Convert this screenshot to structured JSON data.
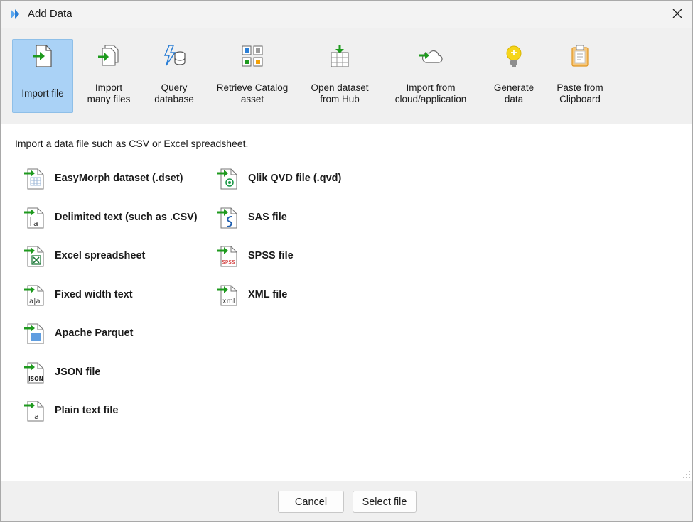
{
  "window": {
    "title": "Add Data"
  },
  "ribbon": {
    "buttons": [
      {
        "label": "Import file",
        "icon": "import-file-icon",
        "active": true
      },
      {
        "label": "Import\nmany files",
        "icon": "import-many-files-icon",
        "active": false
      },
      {
        "label": "Query\ndatabase",
        "icon": "query-database-icon",
        "active": false
      },
      {
        "label": "Retrieve Catalog\nasset",
        "icon": "catalog-asset-icon",
        "active": false
      },
      {
        "label": "Open dataset\nfrom Hub",
        "icon": "hub-dataset-icon",
        "active": false
      },
      {
        "label": "Import from\ncloud/application",
        "icon": "cloud-import-icon",
        "active": false
      },
      {
        "label": "Generate\ndata",
        "icon": "lightbulb-icon",
        "active": false
      },
      {
        "label": "Paste from\nClipboard",
        "icon": "clipboard-icon",
        "active": false
      }
    ]
  },
  "description": "Import a data file such as CSV or Excel spreadsheet.",
  "file_types": {
    "left": [
      {
        "label": "EasyMorph dataset (.dset)",
        "icon": "dset-file-icon"
      },
      {
        "label": "Delimited text (such as .CSV)",
        "icon": "csv-file-icon"
      },
      {
        "label": "Excel spreadsheet",
        "icon": "excel-file-icon"
      },
      {
        "label": "Fixed width text",
        "icon": "fixed-width-file-icon"
      },
      {
        "label": "Apache Parquet",
        "icon": "parquet-file-icon"
      },
      {
        "label": "JSON file",
        "icon": "json-file-icon"
      },
      {
        "label": "Plain text file",
        "icon": "text-file-icon"
      }
    ],
    "right": [
      {
        "label": "Qlik QVD file (.qvd)",
        "icon": "qvd-file-icon"
      },
      {
        "label": "SAS file",
        "icon": "sas-file-icon"
      },
      {
        "label": "SPSS file",
        "icon": "spss-file-icon"
      },
      {
        "label": "XML file",
        "icon": "xml-file-icon"
      }
    ],
    "icon_texts": {
      "json": "JSON",
      "spss": "SPSS",
      "xml": "xml",
      "csv": "a",
      "txt": "a",
      "fixed": "a|a"
    }
  },
  "footer": {
    "cancel_label": "Cancel",
    "select_label": "Select file"
  },
  "colors": {
    "accent_arrow": "#1e9a1e",
    "active_tab": "#aad2f6",
    "logo": "#3a8ee6"
  }
}
